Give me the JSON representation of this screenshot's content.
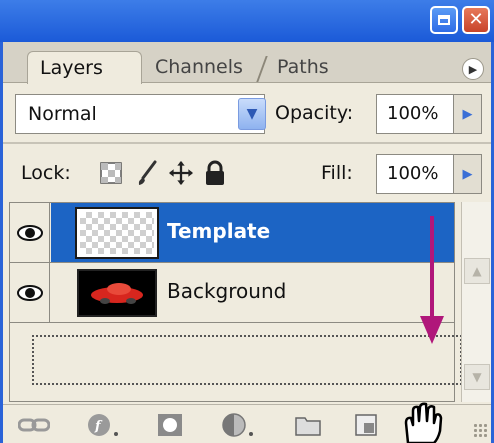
{
  "window": {
    "minimize_icon": "minimize-icon",
    "close_icon": "close-icon",
    "title_color": "#2a63d8"
  },
  "tabs": [
    {
      "label": "Layers",
      "active": true
    },
    {
      "label": "Channels",
      "active": false
    },
    {
      "label": "Paths",
      "active": false
    }
  ],
  "blend": {
    "mode": "Normal",
    "opacity_label": "Opacity:",
    "opacity_value": "100%"
  },
  "lock": {
    "label": "Lock:",
    "icons": [
      "lock-transparent-pixels-icon",
      "lock-image-pixels-icon",
      "lock-position-icon",
      "lock-all-icon"
    ],
    "fill_label": "Fill:",
    "fill_value": "100%"
  },
  "layers": [
    {
      "name": "Template",
      "selected": true,
      "thumbnail": "transparent-checker",
      "visible": true
    },
    {
      "name": "Background",
      "selected": false,
      "thumbnail": "red-car-on-black",
      "visible": true
    }
  ],
  "annotations": {
    "arrow_color": "#b0177a",
    "cursor": "hand-grab-cursor-icon"
  },
  "toolbar": {
    "icons": [
      "link-layers-icon",
      "layer-style-icon",
      "add-mask-icon",
      "adjustment-layer-icon",
      "new-group-icon",
      "new-layer-icon",
      "delete-layer-icon"
    ]
  },
  "selection_color": "#1c64c4"
}
